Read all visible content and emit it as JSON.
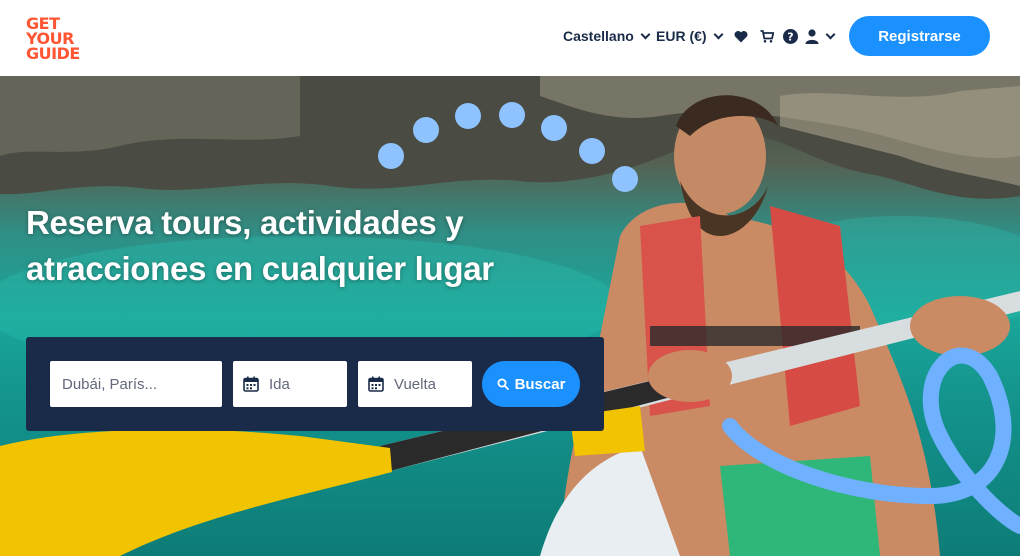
{
  "brand": {
    "logo_lines": [
      "GET",
      "YOUR",
      "GUIDE"
    ],
    "logo_color": "#ff5533",
    "accent": "#1a91ff",
    "navy": "#1a2b49"
  },
  "header": {
    "language": "Castellano",
    "currency": "EUR (€)",
    "icons": [
      "heart-icon",
      "cart-icon",
      "help-icon",
      "user-icon"
    ],
    "register_label": "Registrarse"
  },
  "hero": {
    "headline_line1": "Reserva tours, actividades y",
    "headline_line2": "atracciones en cualquier lugar"
  },
  "search": {
    "destination_placeholder": "Dubái, París...",
    "start_label": "Ida",
    "end_label": "Vuelta",
    "button_label": "Buscar"
  }
}
